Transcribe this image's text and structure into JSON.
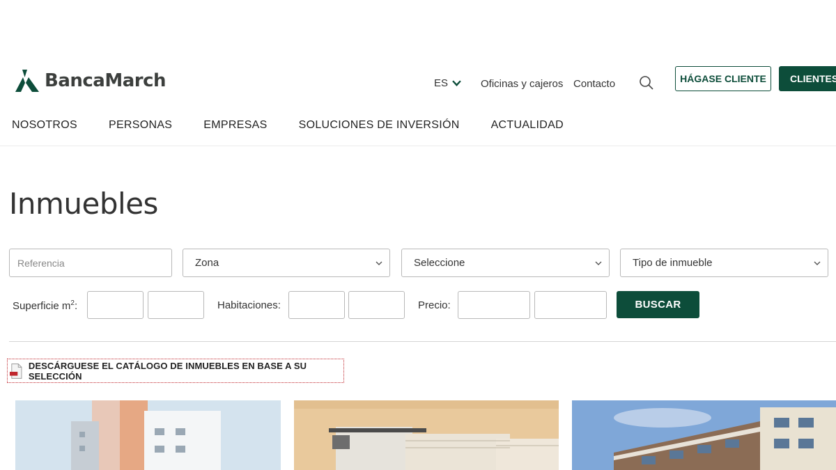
{
  "header": {
    "logo_text": "BancaMarch",
    "lang": "ES",
    "links": [
      "Oficinas y cajeros",
      "Contacto"
    ],
    "btn_hagase": "HÁGASE CLIENTE",
    "btn_clientes": "CLIENTES"
  },
  "nav": [
    "NOSOTROS",
    "PERSONAS",
    "EMPRESAS",
    "SOLUCIONES DE INVERSIÓN",
    "ACTUALIDAD"
  ],
  "page_title": "Inmuebles",
  "filters": {
    "referencia_placeholder": "Referencia",
    "zona": "Zona",
    "seleccione": "Seleccione",
    "tipo": "Tipo de inmueble",
    "superficie_label": "Superficie m",
    "superficie_sup": "2",
    "superficie_colon": ":",
    "habitaciones_label": "Habitaciones:",
    "precio_label": "Precio:",
    "buscar": "BUSCAR"
  },
  "catalog_link": "DESCÁRGUESE EL CATÁLOGO DE INMUEBLES EN BASE A SU SELECCIÓN",
  "colors": {
    "brand": "#0d4d3a",
    "catalog_border": "#c0262d"
  }
}
